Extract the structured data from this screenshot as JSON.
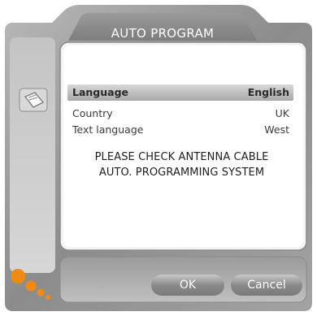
{
  "dialog": {
    "title": "AUTO PROGRAM"
  },
  "settings": [
    {
      "label": "Language",
      "value": "English",
      "selected": true
    },
    {
      "label": "Country",
      "value": "UK",
      "selected": false
    },
    {
      "label": "Text language",
      "value": "West",
      "selected": false
    }
  ],
  "messages": {
    "line1": "PLEASE CHECK ANTENNA CABLE",
    "line2": "AUTO. PROGRAMMING SYSTEM"
  },
  "buttons": {
    "ok": "OK",
    "cancel": "Cancel"
  },
  "icons": {
    "side": "menu-sheet-icon",
    "logo": "orange-dots-logo"
  },
  "colors": {
    "frame": "#8f8f8f",
    "panel": "#f2f2f2",
    "accent": "#f08a12"
  }
}
